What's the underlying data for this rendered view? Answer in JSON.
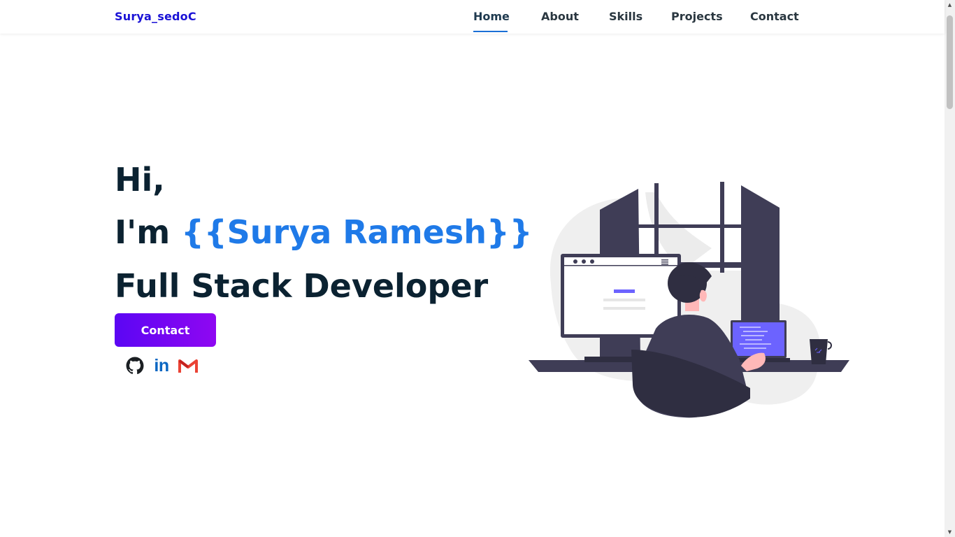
{
  "header": {
    "logo": "Surya_sedoC",
    "nav": [
      {
        "label": "Home",
        "active": true
      },
      {
        "label": "About",
        "active": false
      },
      {
        "label": "Skills",
        "active": false
      },
      {
        "label": "Projects",
        "active": false
      },
      {
        "label": "Contact",
        "active": false
      }
    ]
  },
  "hero": {
    "greeting": "Hi,",
    "intro_prefix": "I'm ",
    "name": "{{Surya Ramesh}}",
    "role": "Full Stack Developer",
    "contact_button": "Contact",
    "socials": [
      {
        "name": "github",
        "icon": "github-icon"
      },
      {
        "name": "linkedin",
        "icon": "linkedin-icon",
        "label": "in"
      },
      {
        "name": "gmail",
        "icon": "gmail-icon"
      }
    ]
  },
  "colors": {
    "logo": "#1a12d6",
    "accent": "#1f7ae8",
    "heading": "#0b2231",
    "button_gradient_start": "#5b06f3",
    "button_gradient_end": "#8f07f2",
    "illustration_dark": "#3f3d56",
    "illustration_accent": "#6c63ff"
  }
}
